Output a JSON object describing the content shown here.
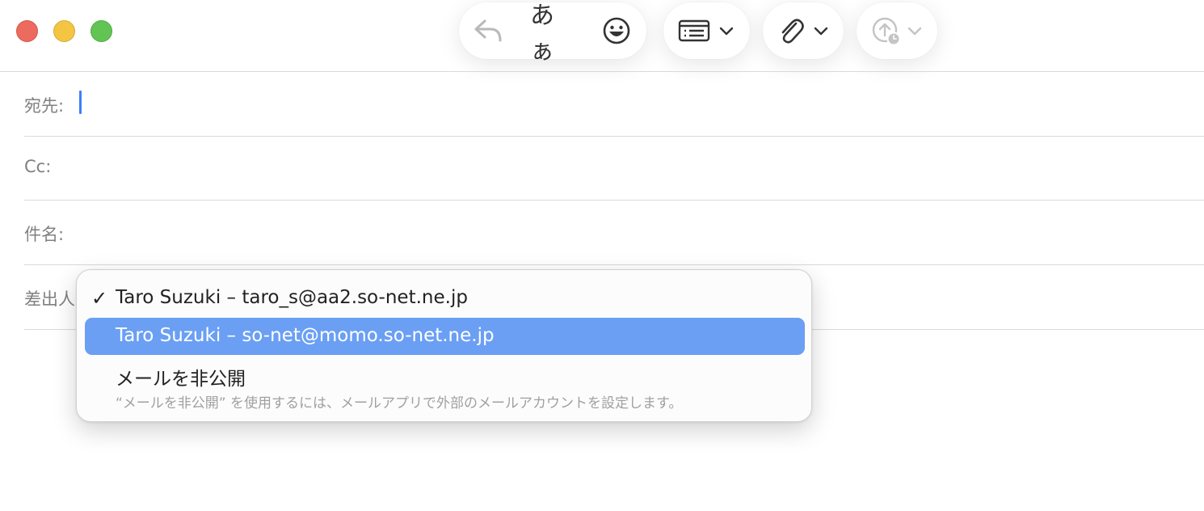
{
  "window": {
    "controls": [
      "close",
      "minimize",
      "zoom"
    ],
    "colors": {
      "close": "#ed6a5e",
      "minimize": "#f4c443",
      "zoom": "#62c454"
    }
  },
  "toolbar": {
    "reply_icon": "reply-icon",
    "format_label": "あぁ",
    "emoji_icon": "emoji-icon",
    "header_fields_icon": "header-fields-icon",
    "attach_icon": "paperclip-icon",
    "send_later_icon": "send-later-icon"
  },
  "fields": {
    "to_label": "宛先:",
    "cc_label": "Cc:",
    "subject_label": "件名:",
    "from_label": "差出人"
  },
  "from_menu": {
    "items": [
      {
        "check": "✓",
        "label": "Taro Suzuki – taro_s@aa2.so-net.ne.jp",
        "checked": true
      },
      {
        "label": "Taro Suzuki – so-net@momo.so-net.ne.jp",
        "highlighted": true
      },
      {
        "label": "メールを非公開",
        "description": "“メールを非公開” を使用するには、メールアプリで外部のメールアカウントを設定します。"
      }
    ],
    "highlight_color": "#6a9ff4"
  },
  "accent": "#3b82f6"
}
